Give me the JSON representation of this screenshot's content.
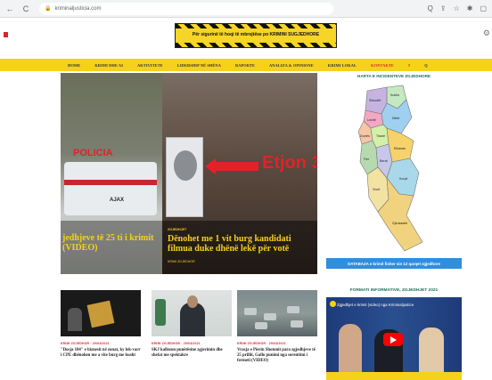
{
  "browser": {
    "back": "←",
    "reload": "C",
    "url": "kriminaljusticia.com",
    "icons": [
      "Q",
      "⇪",
      "☆",
      "✱",
      "▢"
    ]
  },
  "header": {
    "banner_text": "Për sigurinë të hoqi të mbrojtëse po KRIMINI SUGJEDHORE"
  },
  "nav": {
    "items": [
      {
        "label": "HOME",
        "accent": false
      },
      {
        "label": "KRIMI DHE AI",
        "accent": false
      },
      {
        "label": "AKTIVITETE",
        "accent": false
      },
      {
        "label": "LIDERSHIP NË SHËNA",
        "accent": false
      },
      {
        "label": "RAPORTE",
        "accent": false
      },
      {
        "label": "ANALIZA & OPINIONE",
        "accent": false
      },
      {
        "label": "KRIMI LOKAL",
        "accent": false
      },
      {
        "label": "KONTAKTE",
        "accent": true
      },
      {
        "label": "?",
        "accent": false
      },
      {
        "label": "Q",
        "accent": false
      }
    ]
  },
  "featured": {
    "left_title": "jedhjeve të 25 ti i krimit (VIDEO)",
    "left_police_text": "POLICIA",
    "left_van_text": "AJAX",
    "right_photo_text": "Etjon 3",
    "right_category": "ZGJEDHJET",
    "right_title": "Dënohet me 1 vit burg kandidati filmua duke dhënë lekë për votë",
    "right_meta": "KRIMI ZGJEDHOR"
  },
  "sidebar": {
    "map_title": "HARTA E INCIDENTEVE ZGJEDHORE",
    "map_button": "DATABAZA e krimit fisher sin 12 qarqet zgjedhore",
    "regions": [
      "Kukës",
      "Shkodër",
      "Lezhë",
      "Dibër",
      "Durrës",
      "Tiranë",
      "Elbasan",
      "Fier",
      "Berat",
      "Korçë",
      "Vlorë",
      "Gjirokastër"
    ],
    "video_title": "FORMATI INFORMATIVE, ZGJEDHJET 2021",
    "video_caption": "Zgjedhjet e krimit (video) nga Kriminaljustice"
  },
  "articles": [
    {
      "category": "KRIMI ZGJEDHOR · 29/04/2021",
      "title": "\"Dosja 184\" e biznesit në zonat, ky lek-varr i CPE dhënohen me a vite burg me kusht"
    },
    {
      "category": "KRIMI ZGJEDHOR · 29/04/2021",
      "title": "SKJ kallezon punëtësine zgjerimin dhe shefat me spektakre"
    },
    {
      "category": "KRIMI ZGJEDHOR · 29/04/2021",
      "title": "Vrasja e Pierin Shotonit para zgjedhjeve të 25 prillit, Gallo punimi nga sorentimi i fermeti (VIDEO)"
    }
  ]
}
